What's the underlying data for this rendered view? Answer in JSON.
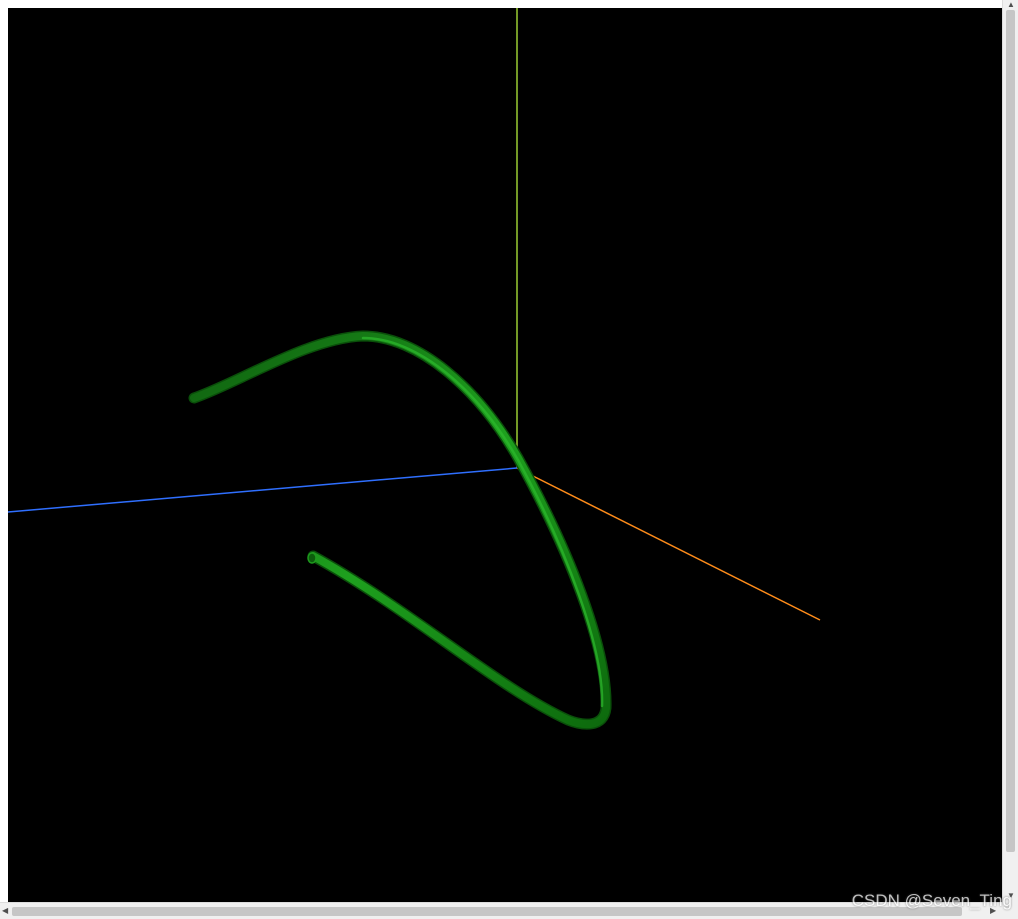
{
  "scene": {
    "background": "#000000",
    "axes": {
      "x_color": "#ff8c1a",
      "y_color": "#9acd32",
      "z_color": "#2f6fff"
    },
    "tube_color": "#1f9a1f"
  },
  "watermark": {
    "text": "CSDN @Seven_Ting"
  }
}
